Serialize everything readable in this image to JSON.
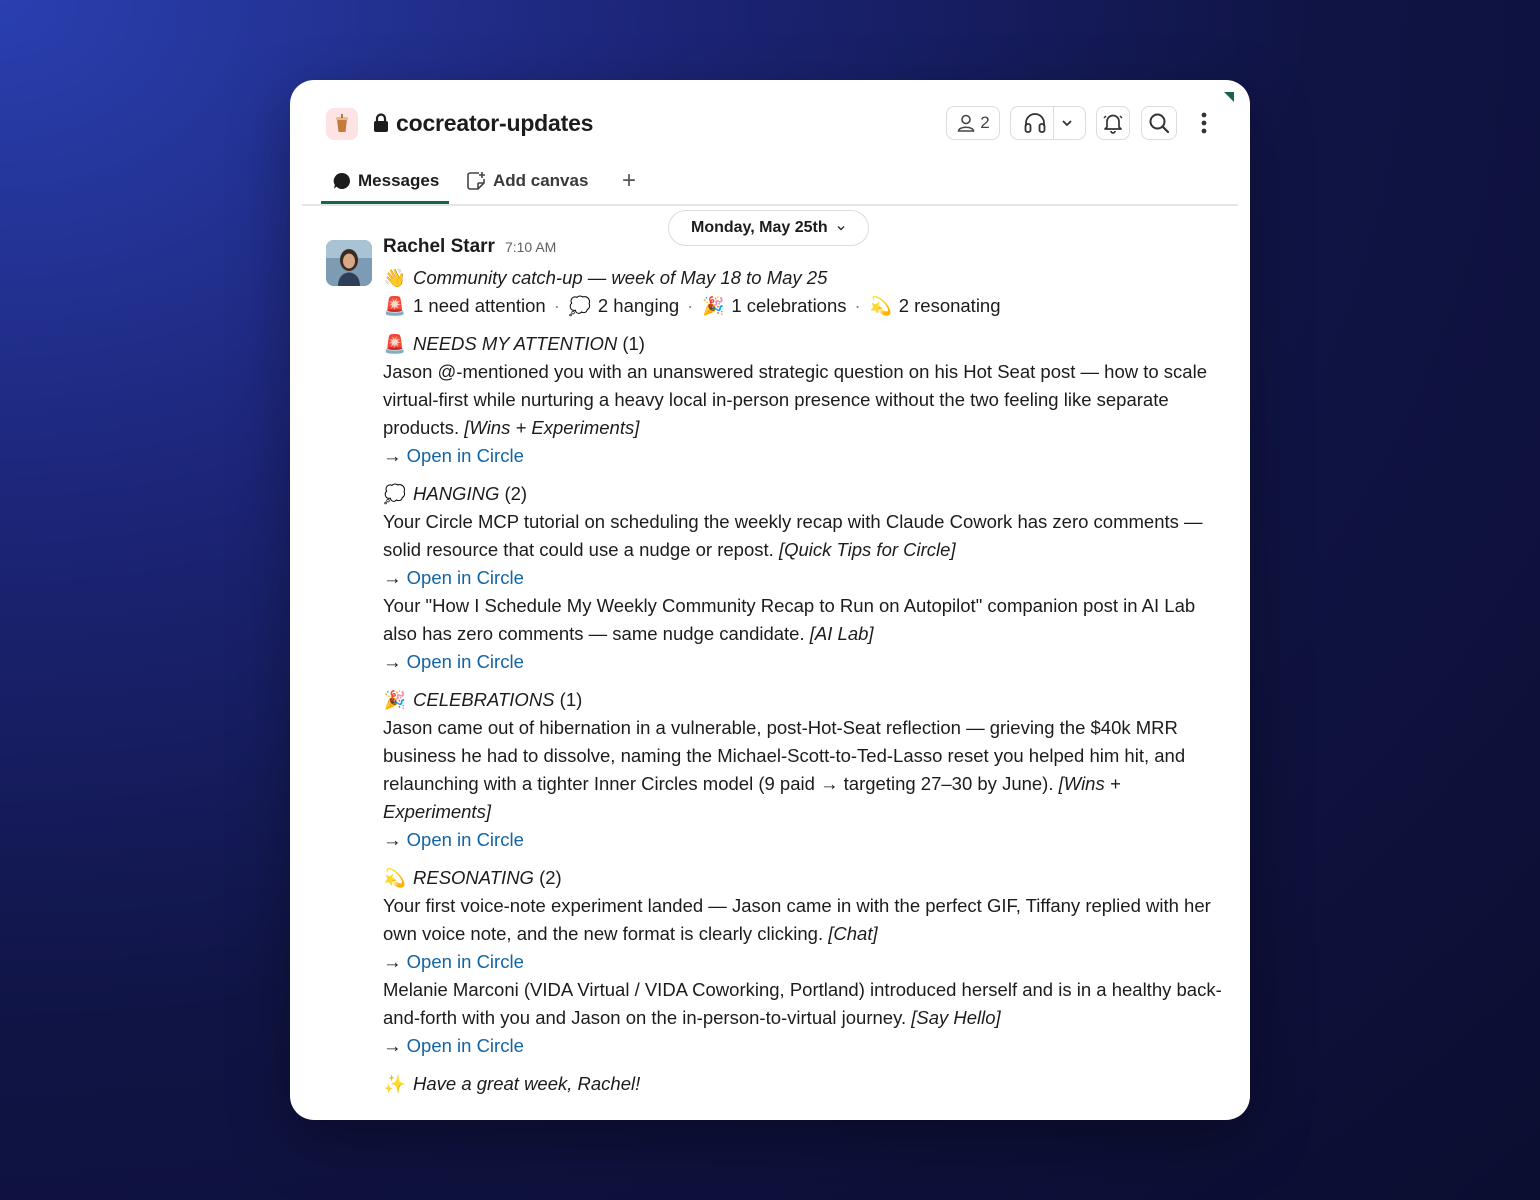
{
  "channel": {
    "name": "cocreator-updates",
    "workspace_icon": "cup-icon"
  },
  "header": {
    "member_count": "2"
  },
  "tabs": {
    "messages": "Messages",
    "add_canvas": "Add canvas",
    "add": "+"
  },
  "date_divider": "Monday, May 25th",
  "message": {
    "sender": "Rachel Starr",
    "time": "7:10 AM",
    "intro": "Community catch-up — week of May 18 to May 25",
    "summary": {
      "need_attention": "1 need attention",
      "hanging": "2 hanging",
      "celebrations": "1 celebrations",
      "resonating": "2 resonating",
      "separator": "·"
    },
    "link_arrow": "→",
    "link_text": "Open in Circle",
    "sections": {
      "attention": {
        "title": "NEEDS MY ATTENTION",
        "count": "(1)",
        "items": [
          {
            "text": "Jason @-mentioned you with an unanswered strategic question on his Hot Seat post — how to scale virtual-first while nurturing a heavy local in-person presence without the two feeling like separate products.",
            "tag": "[Wins + Experiments]"
          }
        ]
      },
      "hanging": {
        "title": "HANGING",
        "count": "(2)",
        "items": [
          {
            "text": "Your Circle MCP tutorial on scheduling the weekly recap with Claude Cowork has zero comments — solid resource that could use a nudge or repost.",
            "tag": "[Quick Tips for Circle]"
          },
          {
            "text": "Your \"How I Schedule My Weekly Community Recap to Run on Autopilot\" companion post in AI Lab also has zero comments — same nudge candidate.",
            "tag": "[AI Lab]"
          }
        ]
      },
      "celebrations": {
        "title": "CELEBRATIONS",
        "count": "(1)",
        "items": [
          {
            "text": "Jason came out of hibernation in a vulnerable, post-Hot-Seat reflection — grieving the $40k MRR business he had to dissolve, naming the Michael-Scott-to-Ted-Lasso reset you helped him hit, and relaunching with a tighter Inner Circles model (9 paid → targeting 27–30 by June).",
            "tag": "[Wins + Experiments]"
          }
        ]
      },
      "resonating": {
        "title": "RESONATING",
        "count": "(2)",
        "items": [
          {
            "text": "Your first voice-note experiment landed — Jason came in with the perfect GIF, Tiffany replied with her own voice note, and the new format is clearly clicking.",
            "tag": "[Chat]"
          },
          {
            "text": "Melanie Marconi (VIDA Virtual / VIDA Coworking, Portland) introduced herself and is in a healthy back-and-forth with you and Jason on the in-person-to-virtual journey.",
            "tag": "[Say Hello]"
          }
        ]
      }
    },
    "signoff": "Have a great week, Rachel!"
  },
  "icons": {
    "wave": "👋",
    "siren": "🚨",
    "cloud": "💭",
    "party": "🎉",
    "dizzy": "💫",
    "sparkles": "✨"
  }
}
